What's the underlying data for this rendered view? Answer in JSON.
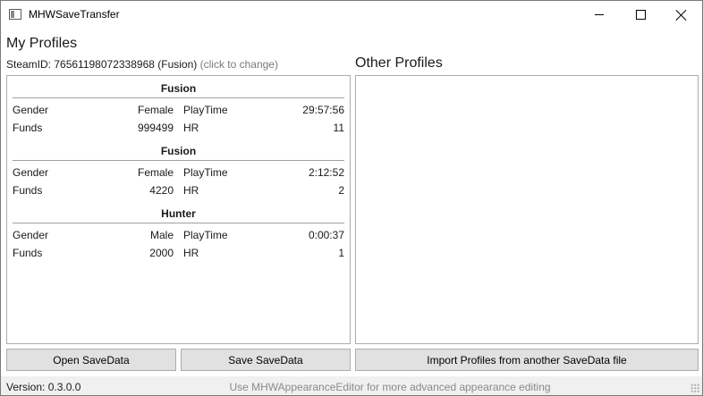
{
  "window": {
    "title": "MHWSaveTransfer"
  },
  "my_profiles": {
    "heading": "My Profiles",
    "steam_id_text": "SteamID: 76561198072338968 (Fusion)",
    "steam_id_hint": "(click to change)",
    "profiles": [
      {
        "name": "Fusion",
        "gender_label": "Gender",
        "gender": "Female",
        "playtime_label": "PlayTime",
        "playtime": "29:57:56",
        "funds_label": "Funds",
        "funds": "999499",
        "hr_label": "HR",
        "hr": "11"
      },
      {
        "name": "Fusion",
        "gender_label": "Gender",
        "gender": "Female",
        "playtime_label": "PlayTime",
        "playtime": "2:12:52",
        "funds_label": "Funds",
        "funds": "4220",
        "hr_label": "HR",
        "hr": "2"
      },
      {
        "name": "Hunter",
        "gender_label": "Gender",
        "gender": "Male",
        "playtime_label": "PlayTime",
        "playtime": "0:00:37",
        "funds_label": "Funds",
        "funds": "2000",
        "hr_label": "HR",
        "hr": "1"
      }
    ]
  },
  "other_profiles": {
    "heading": "Other Profiles"
  },
  "buttons": {
    "open": "Open SaveData",
    "save": "Save SaveData",
    "import": "Import Profiles from another SaveData file"
  },
  "status": {
    "version": "Version: 0.3.0.0",
    "hint": "Use MHWAppearanceEditor for more advanced appearance editing"
  },
  "icons": {
    "app": "app-window-icon",
    "minimize": "minimize-icon",
    "maximize": "maximize-icon",
    "close": "close-icon",
    "grip": "resize-grip-icon"
  }
}
